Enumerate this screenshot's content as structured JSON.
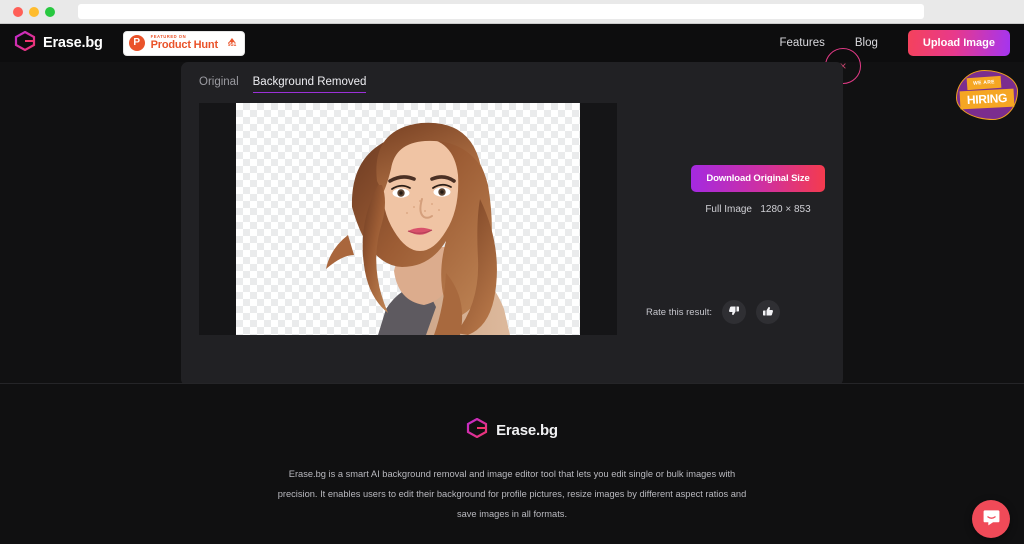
{
  "browser": {
    "traffic_lights": [
      "close",
      "minimize",
      "maximize"
    ],
    "url_value": "",
    "url_placeholder": ""
  },
  "header": {
    "brand": {
      "name": "Erase.bg",
      "logo_icon": "erasebg-cube-icon"
    },
    "product_hunt_badge": {
      "featured_label": "FEATURED ON",
      "name": "Product Hunt",
      "upvote_count": "951",
      "logo_letter": "P"
    },
    "nav": [
      {
        "label": "Features",
        "name": "nav-features"
      },
      {
        "label": "Blog",
        "name": "nav-blog"
      }
    ],
    "upload_button": {
      "label": "Upload Image",
      "gradient_from": "#f4425c",
      "gradient_to": "#a435f0"
    },
    "click_indicator": {
      "glyph": "×",
      "color": "#e23a86"
    }
  },
  "hiring_badge": {
    "top_text": "WE ARE",
    "main_text": "HIRING",
    "blob_color": "#7b2d8e",
    "banner_color": "#f5a623"
  },
  "editor": {
    "tabs": [
      {
        "label": "Original",
        "active": false
      },
      {
        "label": "Background Removed",
        "active": true
      }
    ],
    "active_tab_accent": "#9b30d9",
    "canvas": {
      "checker_light": "#ffffff",
      "checker_dark": "#eaebec",
      "alt_text": "Portrait of a woman with long auburn hair on transparent background"
    },
    "download_button": {
      "label": "Download Original Size"
    },
    "image_info": {
      "label": "Full Image",
      "dimensions": "1280 × 853"
    },
    "rating": {
      "label": "Rate this result:",
      "thumbs_down_icon": "thumbs-down-icon",
      "thumbs_up_icon": "thumbs-up-icon"
    }
  },
  "footer": {
    "brand": {
      "name": "Erase.bg",
      "logo_icon": "erasebg-cube-icon"
    },
    "description": "Erase.bg is a smart AI background removal and image editor tool that lets you edit single or bulk images with precision. It enables users to edit their background for profile pictures, resize images by different aspect ratios and save images in all formats."
  },
  "chat_widget": {
    "icon": "intercom-chat-icon",
    "color": "#f04a58"
  }
}
